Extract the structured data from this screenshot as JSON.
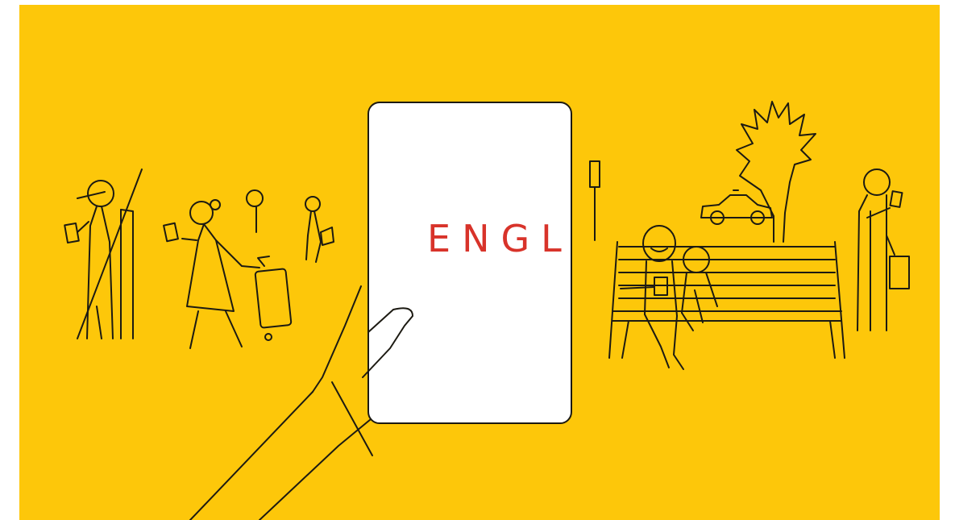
{
  "illustration": {
    "tablet_text": "ENGL",
    "colors": {
      "background": "#fdc70a",
      "ink": "#1c1a12",
      "screen": "#ffffff",
      "text": "#d8332a",
      "border": "#ffffff"
    }
  }
}
